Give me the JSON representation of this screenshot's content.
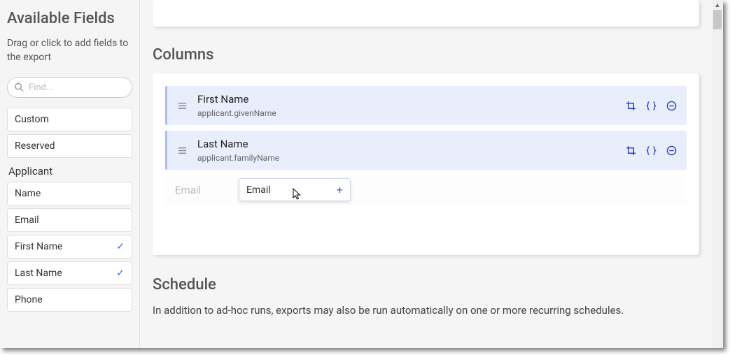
{
  "sidebar": {
    "title": "Available Fields",
    "subtitle": "Drag or click to add fields to the export",
    "search_placeholder": "Find...",
    "top_buttons": [
      "Custom",
      "Reserved"
    ],
    "group_label": "Applicant",
    "fields": [
      {
        "label": "Name",
        "checked": false
      },
      {
        "label": "Email",
        "checked": false
      },
      {
        "label": "First Name",
        "checked": true
      },
      {
        "label": "Last Name",
        "checked": true
      },
      {
        "label": "Phone",
        "checked": false
      }
    ]
  },
  "columns": {
    "section_title": "Columns",
    "items": [
      {
        "name": "First Name",
        "path": "applicant.givenName"
      },
      {
        "name": "Last Name",
        "path": "applicant.familyName"
      }
    ],
    "drop_placeholder": "Email",
    "drag_chip": "Email"
  },
  "schedule": {
    "section_title": "Schedule",
    "description": "In addition to ad-hoc runs, exports may also be run automatically on one or more recurring schedules."
  }
}
